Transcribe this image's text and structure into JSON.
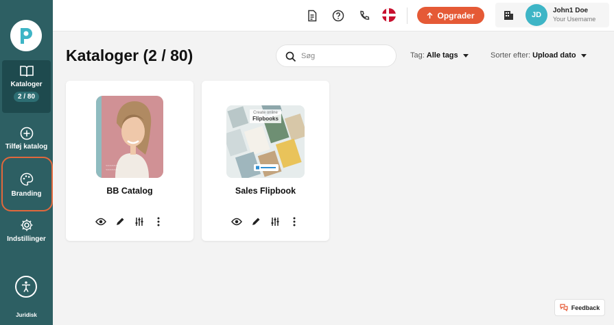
{
  "sidebar": {
    "items": [
      {
        "label": "Kataloger",
        "badge": "2 / 80",
        "icon": "book-open-icon"
      },
      {
        "label": "Tilføj katalog",
        "icon": "plus-circle-icon"
      },
      {
        "label": "Branding",
        "icon": "palette-icon"
      },
      {
        "label": "Indstillinger",
        "icon": "gear-icon"
      }
    ],
    "legal": "Juridisk"
  },
  "topbar": {
    "upgrade_label": "Opgrader",
    "user_name": "John1 Doe",
    "user_sub": "Your Username",
    "avatar_initials": "JD"
  },
  "main": {
    "title": "Kataloger (2 / 80)",
    "search_placeholder": "Søg",
    "tag_label": "Tag:",
    "tag_value": "Alle tags",
    "sort_label": "Sorter efter:",
    "sort_value": "Upload dato"
  },
  "catalogs": [
    {
      "title": "BB Catalog"
    },
    {
      "title": "Sales Flipbook",
      "thumb_heading_small": "Create online",
      "thumb_heading": "Flipbooks"
    }
  ],
  "feedback_label": "Feedback",
  "colors": {
    "sidebar": "#2d5f63",
    "accent": "#e55a36",
    "avatar": "#3eb5c6"
  }
}
